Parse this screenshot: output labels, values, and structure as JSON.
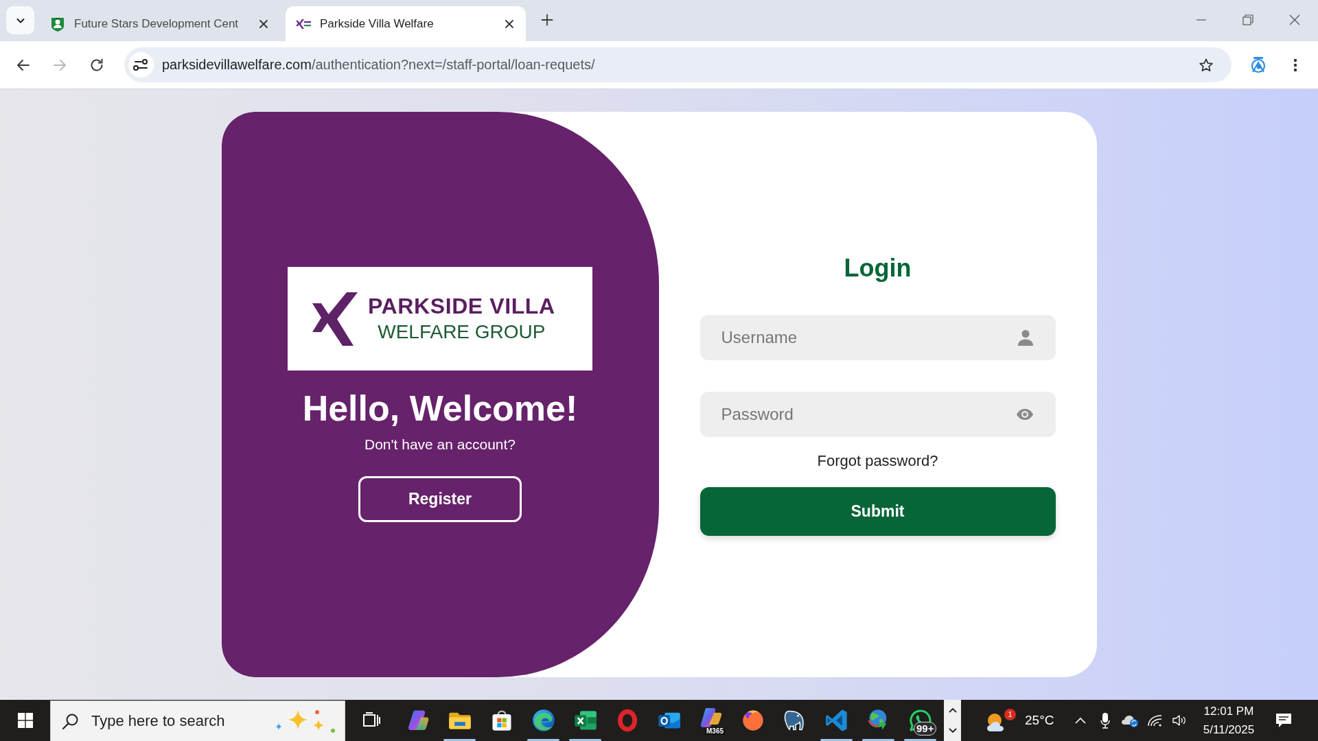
{
  "browser": {
    "tabs": [
      {
        "kind": "mascot",
        "title": "Future Stars Development Cent",
        "selected": false
      },
      {
        "kind": "logo",
        "title": "Parkside Villa Welfare",
        "selected": true
      }
    ],
    "nav_buttons": [
      {
        "kind": "back",
        "disabled": false
      },
      {
        "kind": "forward",
        "disabled": true
      },
      {
        "kind": "reload",
        "disabled": false
      }
    ],
    "address_bar": {
      "host": "parksidevillawelfare.com",
      "path": "/authentication?next=/staff-portal/loan-requets/"
    }
  },
  "welcome": {
    "logo": {
      "line_1": "PARKSIDE VILLA",
      "line_2": "WELFARE GROUP"
    },
    "heading": "Hello, Welcome!",
    "prompt": "Don't have an account?",
    "register_button": "Register"
  },
  "login": {
    "title": "Login",
    "fields": [
      {
        "kind": "username",
        "placeholder": "Username"
      },
      {
        "kind": "password",
        "placeholder": "Password"
      }
    ],
    "forgot_link": "Forgot password?",
    "submit_button": "Submit"
  },
  "taskbar": {
    "search": {
      "placeholder": "Type here to search"
    },
    "apps": [
      {
        "kind": "swirl",
        "running": false
      },
      {
        "kind": "folder",
        "running": true
      },
      {
        "kind": "bag",
        "running": false
      },
      {
        "kind": "wave",
        "running": true
      },
      {
        "kind": "sheet",
        "running": true
      },
      {
        "kind": "ring",
        "running": false
      },
      {
        "kind": "mail",
        "running": false
      },
      {
        "kind": "tile",
        "running": false,
        "label": "M365"
      },
      {
        "kind": "fox",
        "running": false
      },
      {
        "kind": "elephant",
        "running": false
      },
      {
        "kind": "code",
        "running": true
      },
      {
        "kind": "globe",
        "running": true
      },
      {
        "kind": "chat",
        "running": true,
        "badge": "99+"
      }
    ],
    "weather": {
      "badge": "1",
      "temperature": "25°C"
    },
    "clock": {
      "time": "12:01 PM",
      "date": "5/11/2025"
    }
  }
}
